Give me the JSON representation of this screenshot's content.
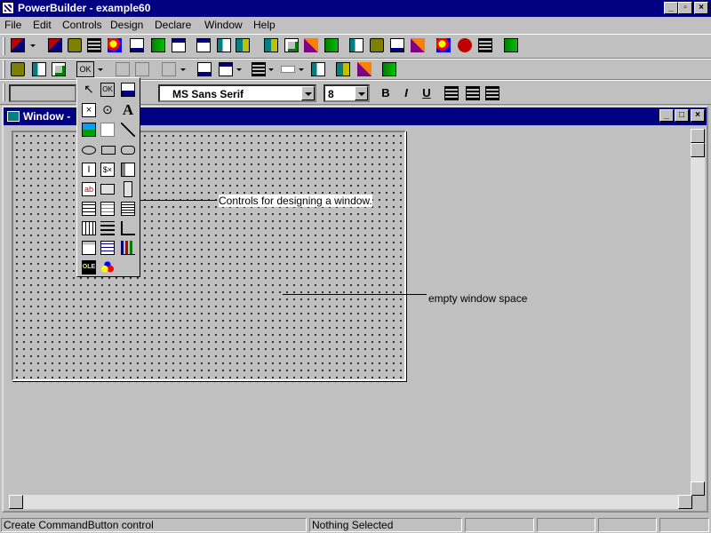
{
  "app": {
    "title": "PowerBuilder - example60"
  },
  "menu": [
    "File",
    "Edit",
    "Controls",
    "Design",
    "Declare",
    "Window",
    "Help"
  ],
  "format_bar": {
    "font_name": "MS Sans Serif",
    "font_size": "8",
    "bold": "B",
    "italic": "I",
    "underline": "U"
  },
  "palette": {
    "ok_label": "OK",
    "text_label": "A"
  },
  "child_window": {
    "title": "Window -"
  },
  "annotations": {
    "controls": "Controls for designing a window.",
    "empty": "empty window space"
  },
  "status": {
    "message": "Create CommandButton control",
    "selection": "Nothing Selected"
  }
}
